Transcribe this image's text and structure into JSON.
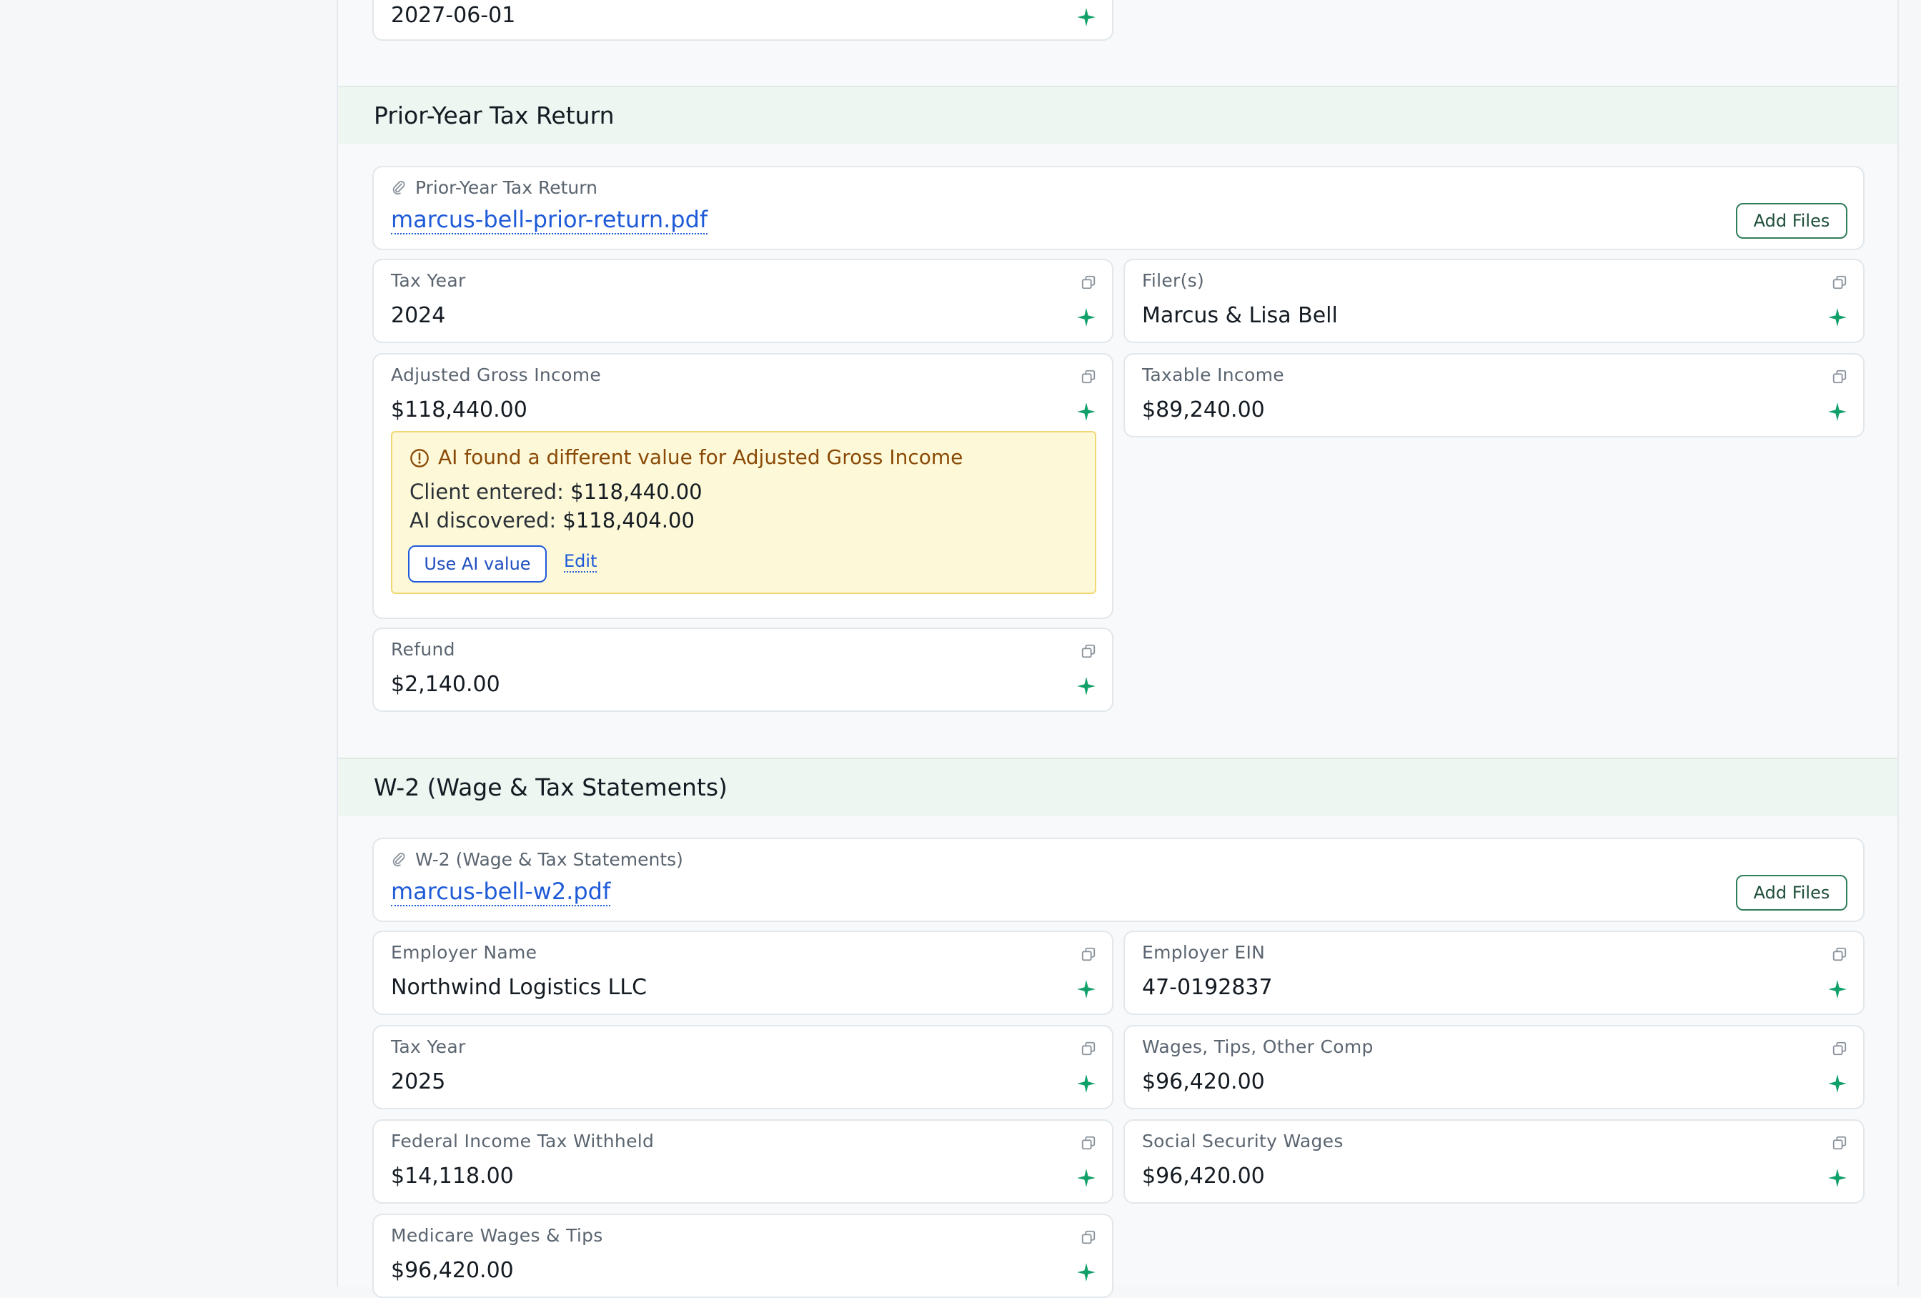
{
  "top_field": {
    "value": "2027-06-01"
  },
  "sections": {
    "prior_year": {
      "title": "Prior-Year Tax Return",
      "file_label": "Prior-Year Tax Return",
      "file_name": "marcus-bell-prior-return.pdf",
      "add_files_label": "Add Files",
      "fields": {
        "tax_year": {
          "label": "Tax Year",
          "value": "2024"
        },
        "filers": {
          "label": "Filer(s)",
          "value": "Marcus & Lisa Bell"
        },
        "agi": {
          "label": "Adjusted Gross Income",
          "value": "$118,440.00"
        },
        "taxable_income": {
          "label": "Taxable Income",
          "value": "$89,240.00"
        },
        "refund": {
          "label": "Refund",
          "value": "$2,140.00"
        }
      },
      "alert": {
        "title": "AI found a different value for Adjusted Gross Income",
        "client_entered_label": "Client entered:",
        "client_entered_value": "$118,440.00",
        "ai_discovered_label": "AI discovered:",
        "ai_discovered_value": "$118,404.00",
        "use_ai_label": "Use AI value",
        "edit_label": "Edit"
      }
    },
    "w2": {
      "title": "W-2 (Wage & Tax Statements)",
      "file_label": "W-2 (Wage & Tax Statements)",
      "file_name": "marcus-bell-w2.pdf",
      "add_files_label": "Add Files",
      "fields": {
        "employer_name": {
          "label": "Employer Name",
          "value": "Northwind Logistics LLC"
        },
        "employer_ein": {
          "label": "Employer EIN",
          "value": "47-0192837"
        },
        "tax_year": {
          "label": "Tax Year",
          "value": "2025"
        },
        "wages": {
          "label": "Wages, Tips, Other Comp",
          "value": "$96,420.00"
        },
        "fed_withheld": {
          "label": "Federal Income Tax Withheld",
          "value": "$14,118.00"
        },
        "ss_wages": {
          "label": "Social Security Wages",
          "value": "$96,420.00"
        },
        "medicare_wages": {
          "label": "Medicare Wages & Tips",
          "value": "$96,420.00"
        }
      }
    }
  },
  "colors": {
    "accent_green": "#12a06a",
    "link_blue": "#1f5bd8",
    "alert_bg": "#fdf9d8",
    "alert_border": "#f1d774",
    "alert_text": "#8a4a07",
    "section_header_bg": "#eef6f1"
  },
  "icons": {
    "copy": "copy-icon",
    "ai_sparkle": "sparkle-icon",
    "attachment": "paperclip-icon",
    "warning": "alert-circle-icon"
  }
}
